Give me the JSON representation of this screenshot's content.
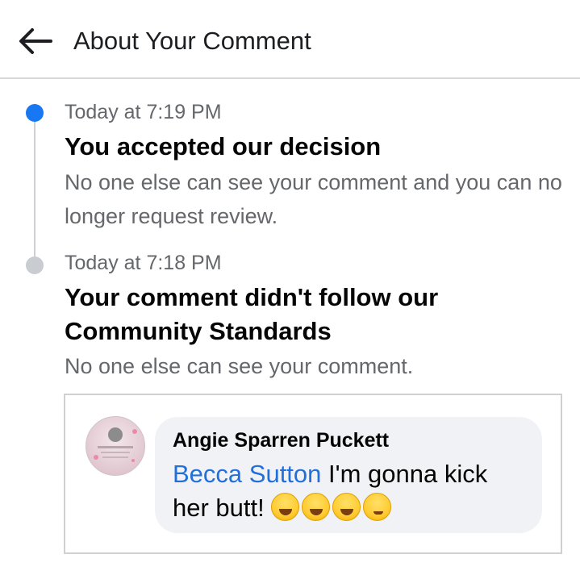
{
  "header": {
    "title": "About Your Comment",
    "back_icon": "arrow-left-icon"
  },
  "timeline": [
    {
      "timestamp": "Today at 7:19 PM",
      "title": "You accepted our decision",
      "description": "No one else can see your comment and you can no longer request review.",
      "status_color": "#1877f2"
    },
    {
      "timestamp": "Today at 7:18 PM",
      "title": "Your comment didn't follow our Community Standards",
      "description": "No one else can see your comment.",
      "status_color": "#c9ccd1"
    }
  ],
  "comment": {
    "author": "Angie Sparren Puckett",
    "mention": "Becca Sutton",
    "text": "I'm gonna kick her butt!",
    "emojis": [
      "face-with-tears-of-joy-emoji",
      "grinning-squinting-face-emoji",
      "grinning-face-with-sweat-emoji",
      "winking-face-emoji"
    ]
  },
  "colors": {
    "accent": "#1877f2",
    "mention": "#216fdb",
    "secondary_text": "#65676b",
    "bubble_bg": "#f0f2f5"
  }
}
